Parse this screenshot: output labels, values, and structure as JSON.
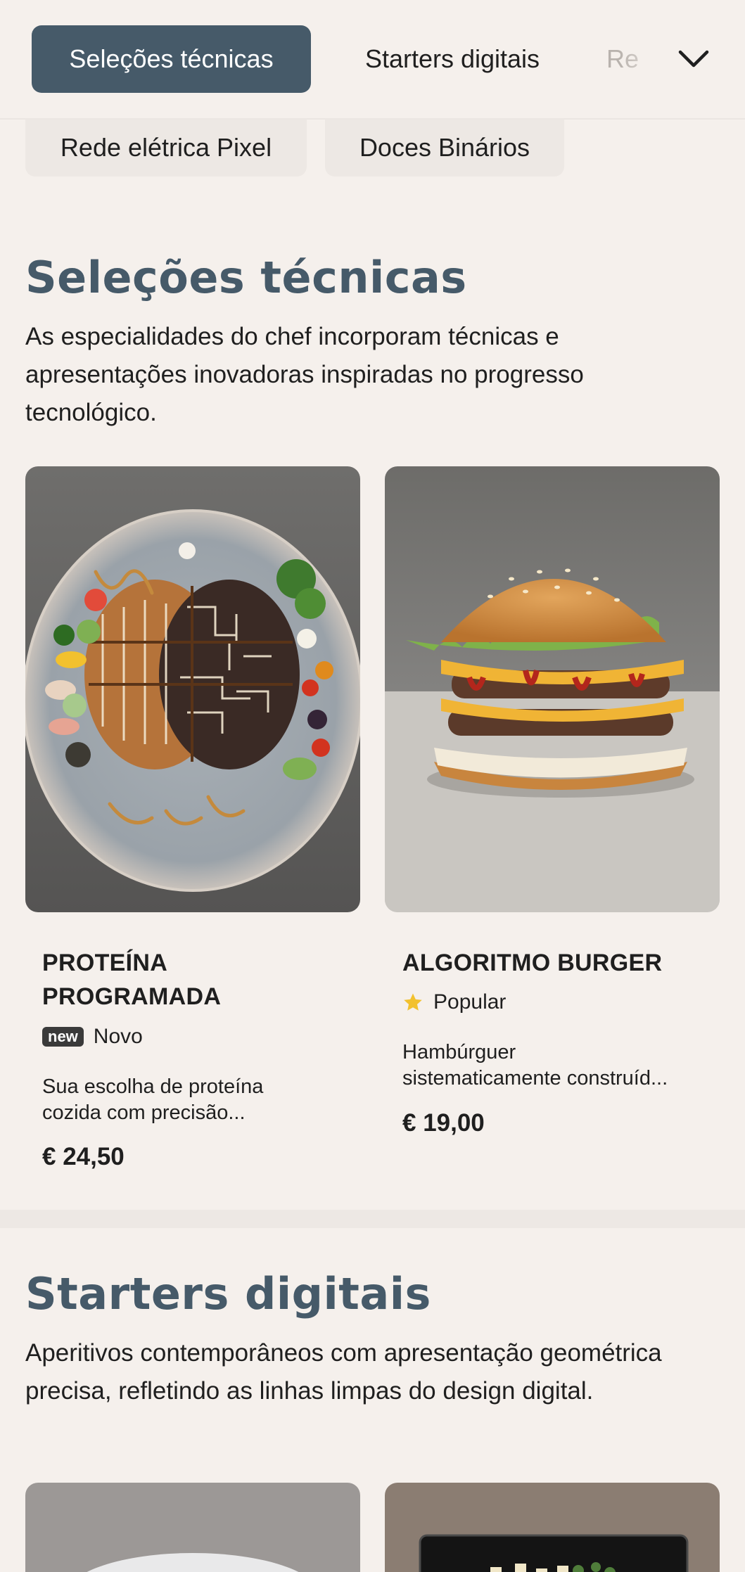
{
  "tabs": [
    {
      "label": "Seleções técnicas"
    },
    {
      "label": "Starters digitais"
    },
    {
      "label": "Re"
    }
  ],
  "chips": [
    {
      "label": "Rede elétrica Pixel"
    },
    {
      "label": "Doces Binários"
    }
  ],
  "sections": [
    {
      "title": "Seleções técnicas",
      "description": "As especialidades do chef incorporam técnicas e apresentações inovadoras inspiradas no progresso tecnológico.",
      "items": [
        {
          "name_line1": "PROTEÍNA",
          "name_line2": "PROGRAMADA",
          "badge_label": "new",
          "tag": "Novo",
          "description_line1": "Sua escolha de proteína",
          "description_line2": "cozida com precisão...",
          "price": "€ 24,50"
        },
        {
          "name": "ALGORITMO BURGER",
          "tag": "Popular",
          "description_line1": "Hambúrguer",
          "description_line2": "sistematicamente construíd...",
          "price": "€ 19,00"
        }
      ]
    },
    {
      "title": "Starters digitais",
      "description": "Aperitivos contemporâneos com apresentação geométrica precisa, refletindo as linhas limpas do design digital."
    }
  ],
  "colors": {
    "accent": "#465a69",
    "background": "#f5f0ec",
    "star": "#f2c12e"
  }
}
